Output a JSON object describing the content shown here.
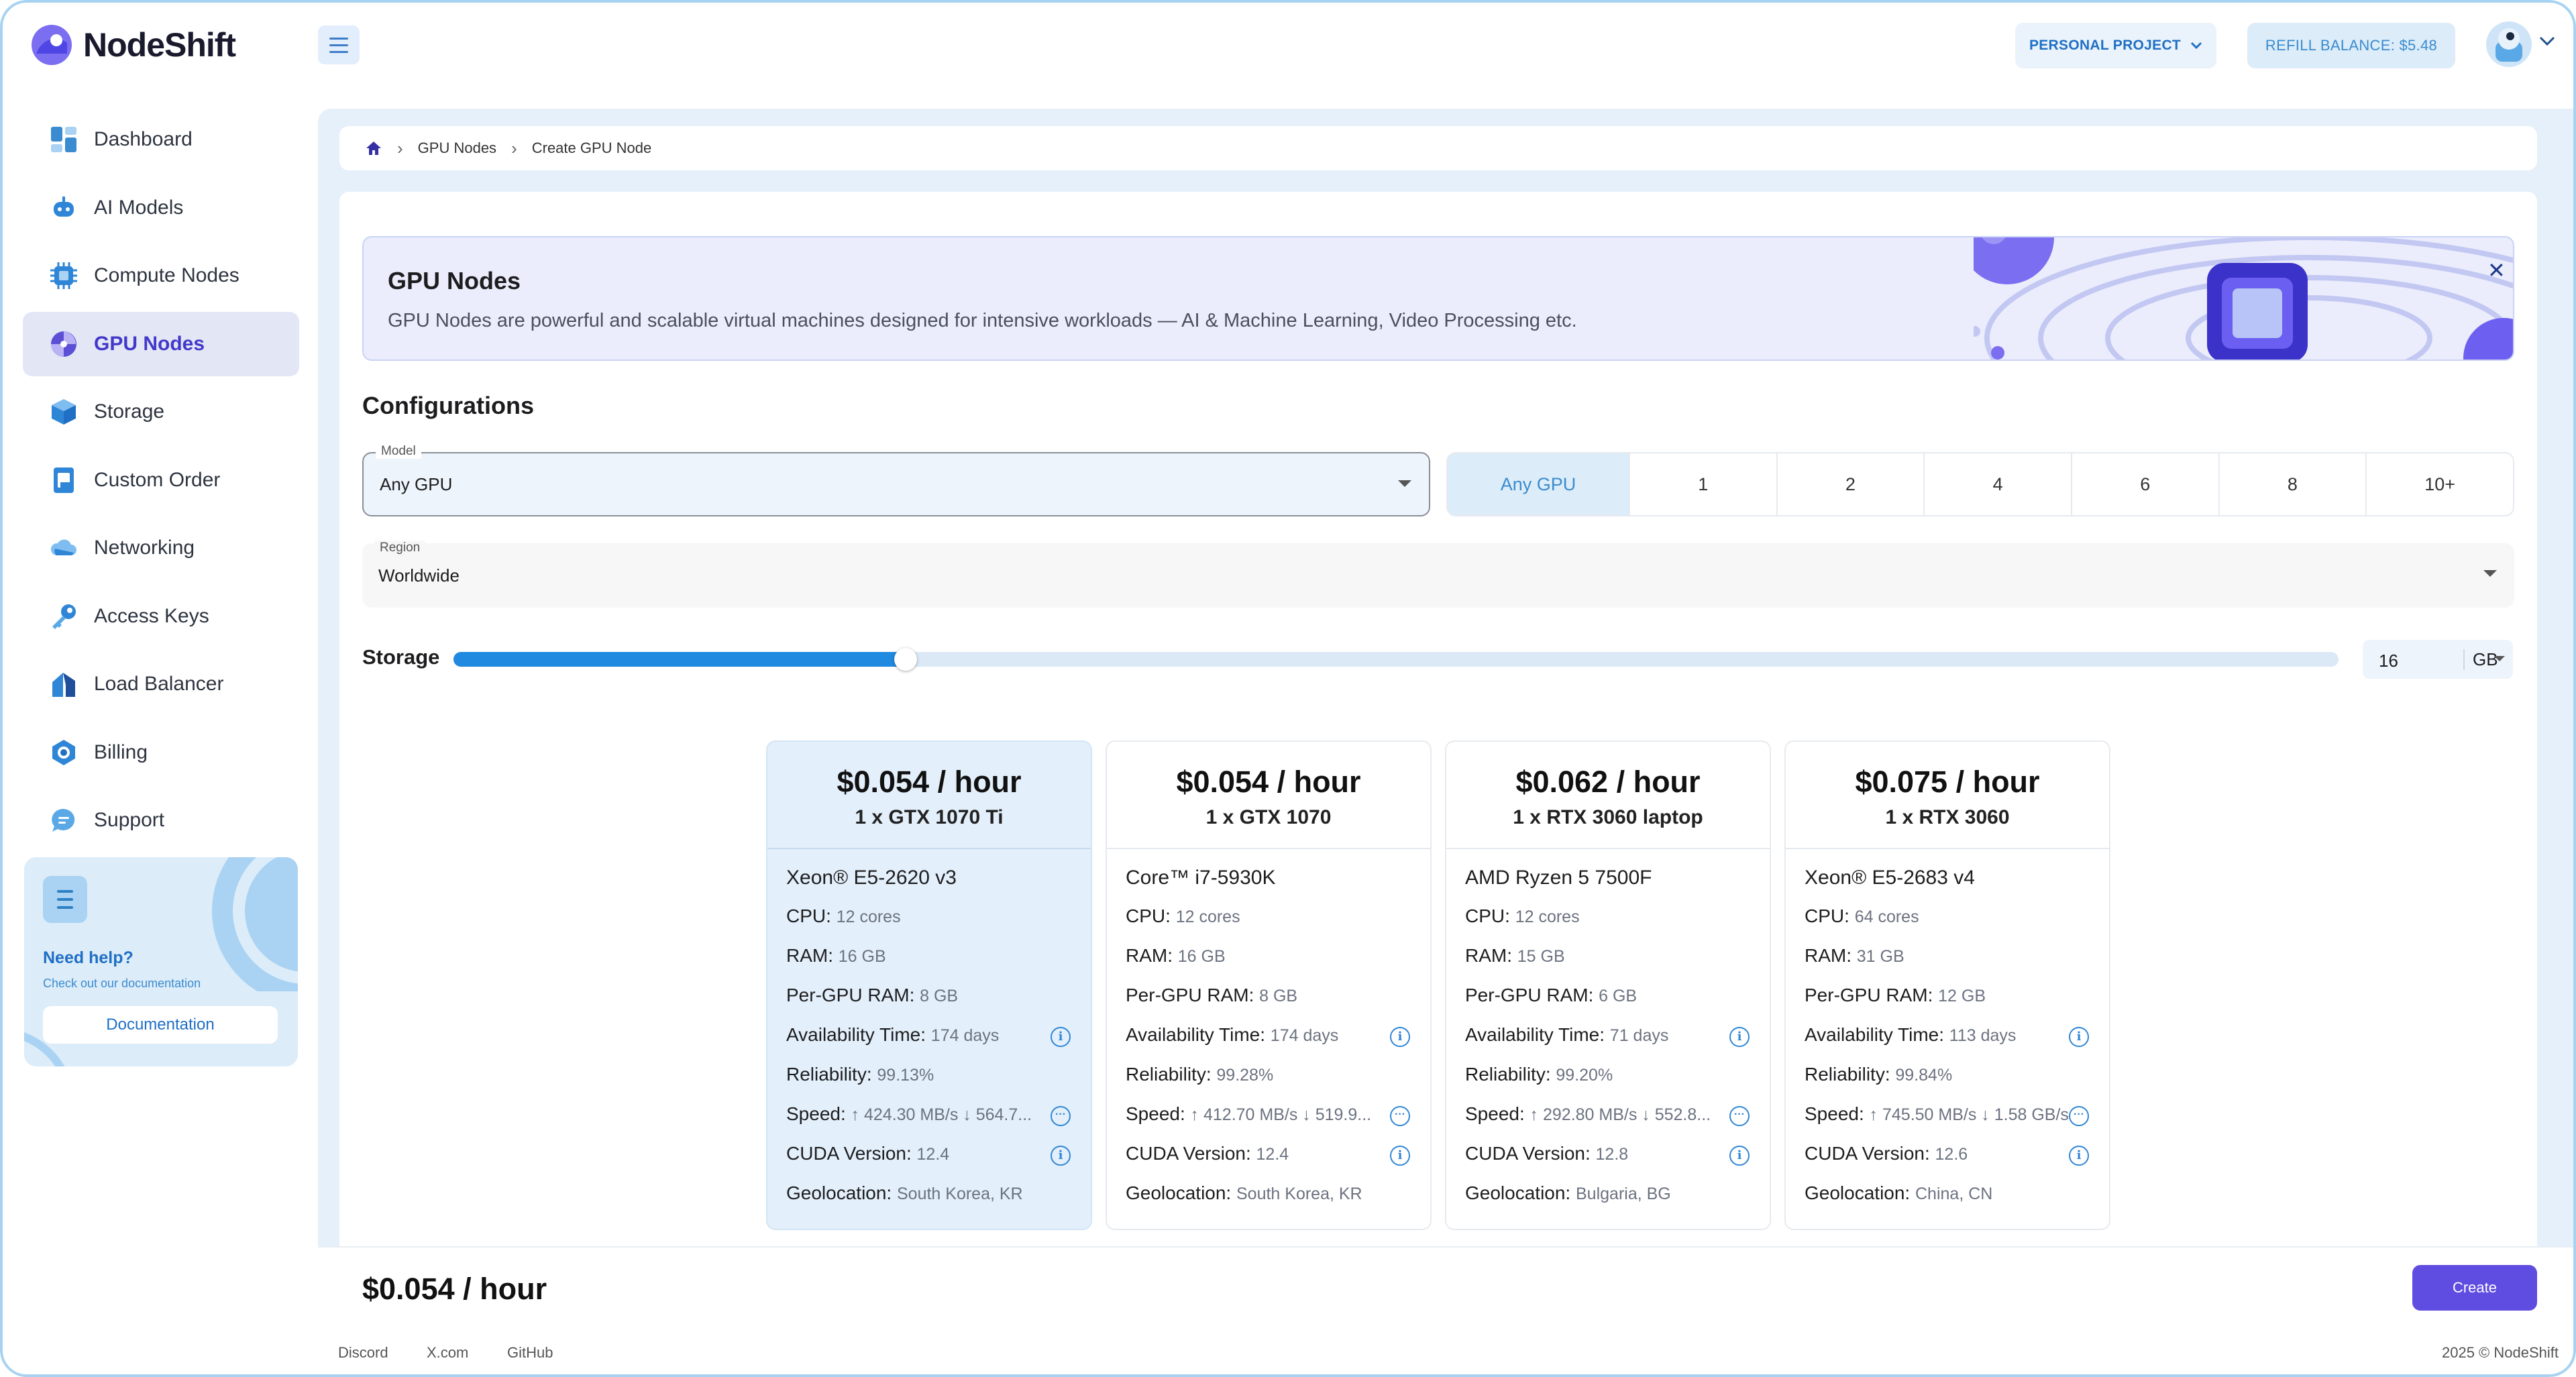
{
  "app": {
    "name": "NodeShift",
    "brand_color": "#5f4ce0",
    "accent_color": "#1f8ae0"
  },
  "header": {
    "project_label": "PERSONAL PROJECT",
    "refill_label": "REFILL BALANCE: $5.48"
  },
  "sidebar": {
    "items": [
      {
        "label": "Dashboard",
        "icon": "dashboard-icon"
      },
      {
        "label": "AI Models",
        "icon": "robot-icon"
      },
      {
        "label": "Compute Nodes",
        "icon": "chip-icon"
      },
      {
        "label": "GPU Nodes",
        "icon": "gpu-icon",
        "active": true
      },
      {
        "label": "Storage",
        "icon": "cube-icon"
      },
      {
        "label": "Custom Order",
        "icon": "document-icon"
      },
      {
        "label": "Networking",
        "icon": "cloud-icon"
      },
      {
        "label": "Access Keys",
        "icon": "key-icon"
      },
      {
        "label": "Load Balancer",
        "icon": "balancer-icon"
      },
      {
        "label": "Billing",
        "icon": "billing-icon"
      },
      {
        "label": "Support",
        "icon": "chat-icon"
      }
    ],
    "help": {
      "title": "Need help?",
      "subtitle": "Check out our documentation",
      "button": "Documentation"
    }
  },
  "breadcrumb": {
    "items": [
      "GPU Nodes",
      "Create GPU Node"
    ]
  },
  "banner": {
    "title": "GPU Nodes",
    "description": "GPU Nodes are powerful and scalable virtual machines designed for intensive workloads — AI & Machine Learning, Video Processing etc."
  },
  "config": {
    "title": "Configurations",
    "model": {
      "label": "Model",
      "value": "Any GPU"
    },
    "gpu_count_options": [
      "Any GPU",
      "1",
      "2",
      "4",
      "6",
      "8",
      "10+"
    ],
    "gpu_count_selected": "Any GPU",
    "region": {
      "label": "Region",
      "value": "Worldwide"
    },
    "storage": {
      "label": "Storage",
      "value": "16",
      "unit": "GB",
      "slider_fraction": 0.24
    }
  },
  "offers": [
    {
      "price": "$0.054 / hour",
      "gpu": "1 x GTX 1070 Ti",
      "cpu_name": "Xeon® E5-2620 v3",
      "cpu": "12 cores",
      "ram": "16 GB",
      "per_gpu_ram": "8 GB",
      "availability": "174 days",
      "reliability": "99.13%",
      "speed": "↑ 424.30 MB/s ↓ 564.7...",
      "cuda": "12.4",
      "geolocation": "South Korea, KR",
      "selected": true
    },
    {
      "price": "$0.054 / hour",
      "gpu": "1 x GTX 1070",
      "cpu_name": "Core™ i7-5930K",
      "cpu": "12 cores",
      "ram": "16 GB",
      "per_gpu_ram": "8 GB",
      "availability": "174 days",
      "reliability": "99.28%",
      "speed": "↑ 412.70 MB/s ↓ 519.9...",
      "cuda": "12.4",
      "geolocation": "South Korea, KR"
    },
    {
      "price": "$0.062 / hour",
      "gpu": "1 x RTX 3060 laptop",
      "cpu_name": "AMD Ryzen 5 7500F",
      "cpu": "12 cores",
      "ram": "15 GB",
      "per_gpu_ram": "6 GB",
      "availability": "71 days",
      "reliability": "99.20%",
      "speed": "↑ 292.80 MB/s ↓ 552.8...",
      "cuda": "12.8",
      "geolocation": "Bulgaria, BG"
    },
    {
      "price": "$0.075 / hour",
      "gpu": "1 x RTX 3060",
      "cpu_name": "Xeon® E5-2683 v4",
      "cpu": "64 cores",
      "ram": "31 GB",
      "per_gpu_ram": "12 GB",
      "availability": "113 days",
      "reliability": "99.84%",
      "speed": "↑ 745.50 MB/s ↓ 1.58 GB/s",
      "cuda": "12.6",
      "geolocation": "China, CN"
    }
  ],
  "labels": {
    "cpu": "CPU:",
    "ram": "RAM:",
    "per_gpu_ram": "Per-GPU RAM:",
    "availability": "Availability Time:",
    "reliability": "Reliability:",
    "speed": "Speed:",
    "cuda": "CUDA Version:",
    "geolocation": "Geolocation:"
  },
  "footer": {
    "total": "$0.054 / hour",
    "create_button": "Create",
    "links": [
      "Discord",
      "X.com",
      "GitHub"
    ],
    "copyright": "2025 © NodeShift"
  }
}
